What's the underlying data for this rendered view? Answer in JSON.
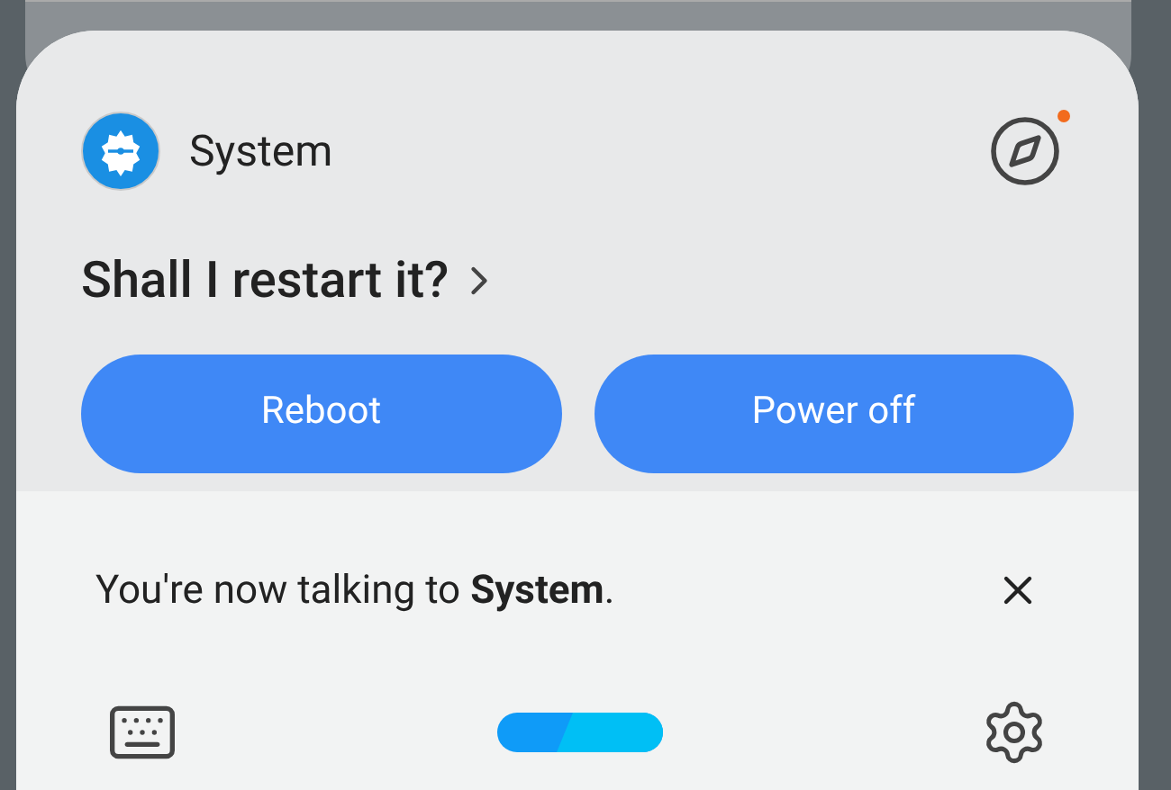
{
  "app": {
    "name": "System"
  },
  "explore": {
    "badge": true
  },
  "prompt": "Shall I restart it?",
  "buttons": [
    "Reboot",
    "Power off"
  ],
  "message": "You're now talking to **System**."
}
